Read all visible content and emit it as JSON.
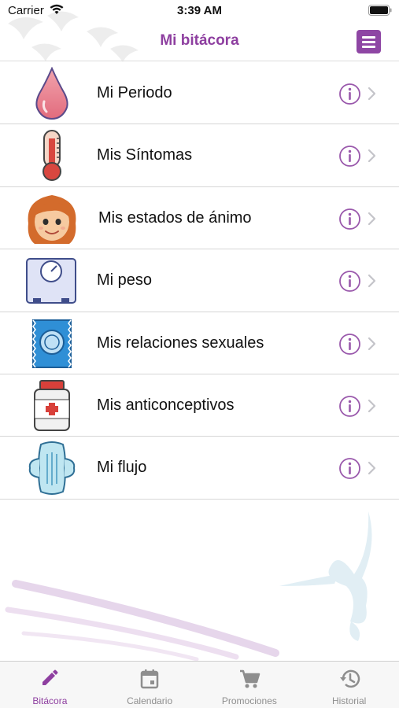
{
  "status_bar": {
    "carrier": "Carrier",
    "time": "3:39 AM",
    "wifi_icon": "wifi-icon",
    "battery_icon": "battery-icon"
  },
  "nav": {
    "title": "Mi bitácora",
    "menu_icon": "hamburger-menu-icon"
  },
  "log_items": [
    {
      "label": "Mi Periodo",
      "icon": "blood-drop-icon"
    },
    {
      "label": "Mis Síntomas",
      "icon": "thermometer-icon"
    },
    {
      "label": "Mis estados de ánimo",
      "icon": "face-avatar-icon"
    },
    {
      "label": "Mi peso",
      "icon": "weight-scale-icon"
    },
    {
      "label": "Mis relaciones sexuales",
      "icon": "condom-icon"
    },
    {
      "label": "Mis anticonceptivos",
      "icon": "pill-bottle-icon"
    },
    {
      "label": "Mi flujo",
      "icon": "sanitary-pad-icon"
    }
  ],
  "row_accessories": {
    "info_icon": "info-icon",
    "chevron_icon": "chevron-right-icon"
  },
  "tab_bar": {
    "tabs": [
      {
        "label": "Bitácora",
        "icon": "pencil-icon",
        "active": true
      },
      {
        "label": "Calendario",
        "icon": "calendar-icon",
        "active": false
      },
      {
        "label": "Promociones",
        "icon": "cart-icon",
        "active": false
      },
      {
        "label": "Historial",
        "icon": "history-icon",
        "active": false
      }
    ]
  },
  "colors": {
    "accent": "#8e3fa0",
    "inactive_tab": "#8e8e8e",
    "divider": "#d6d6d6"
  }
}
